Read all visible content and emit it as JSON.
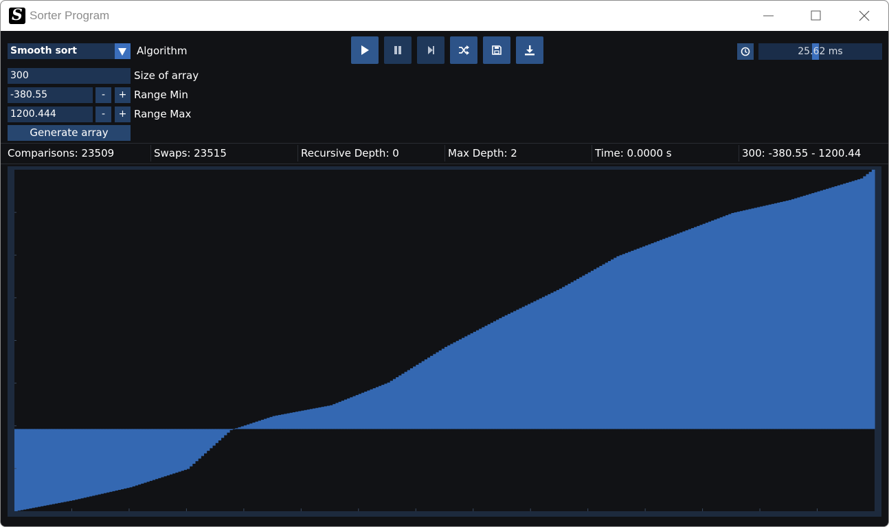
{
  "window": {
    "title": "Sorter Program",
    "logo_letter": "S"
  },
  "controls": {
    "algorithm_value": "Smooth sort",
    "algorithm_label": "Algorithm",
    "size_value": "300",
    "size_label": "Size of array",
    "range_min_value": "-380.55",
    "range_min_label": "Range Min",
    "range_max_value": "1200.444",
    "range_max_label": "Range Max",
    "minus_label": "-",
    "plus_label": "+",
    "generate_label": "Generate array"
  },
  "toolbar": {
    "icons": [
      "play-icon",
      "pause-icon",
      "step-forward-icon",
      "shuffle-icon",
      "save-icon",
      "download-icon"
    ]
  },
  "delay": {
    "icon": "clock-icon",
    "value": "25.62 ms",
    "slider_fraction": 0.46
  },
  "stats": {
    "comparisons": "Comparisons: 23509",
    "swaps": "Swaps: 23515",
    "recursive_depth": "Recursive Depth: 0",
    "max_depth": "Max Depth: 2",
    "time": "Time: 0.0000 s",
    "summary": "300: -380.55 - 1200.44"
  },
  "colors": {
    "bar": "#3468b2",
    "chart_bg": "#111215",
    "border": "#1d2a3d",
    "accent": "#3b6fbd"
  },
  "chart_data": {
    "type": "bar",
    "count": 300,
    "ylim": [
      -380.55,
      1200.444
    ],
    "sorted": true,
    "grid": false,
    "control_points": [
      {
        "index": 0,
        "value": -380.55
      },
      {
        "index": 20,
        "value": -330
      },
      {
        "index": 40,
        "value": -270
      },
      {
        "index": 60,
        "value": -185
      },
      {
        "index": 75,
        "value": -5
      },
      {
        "index": 90,
        "value": 60
      },
      {
        "index": 110,
        "value": 110
      },
      {
        "index": 130,
        "value": 215
      },
      {
        "index": 150,
        "value": 380
      },
      {
        "index": 170,
        "value": 520
      },
      {
        "index": 190,
        "value": 650
      },
      {
        "index": 210,
        "value": 800
      },
      {
        "index": 230,
        "value": 900
      },
      {
        "index": 250,
        "value": 1000
      },
      {
        "index": 270,
        "value": 1060
      },
      {
        "index": 285,
        "value": 1120
      },
      {
        "index": 295,
        "value": 1160
      },
      {
        "index": 299,
        "value": 1200.44
      }
    ]
  }
}
